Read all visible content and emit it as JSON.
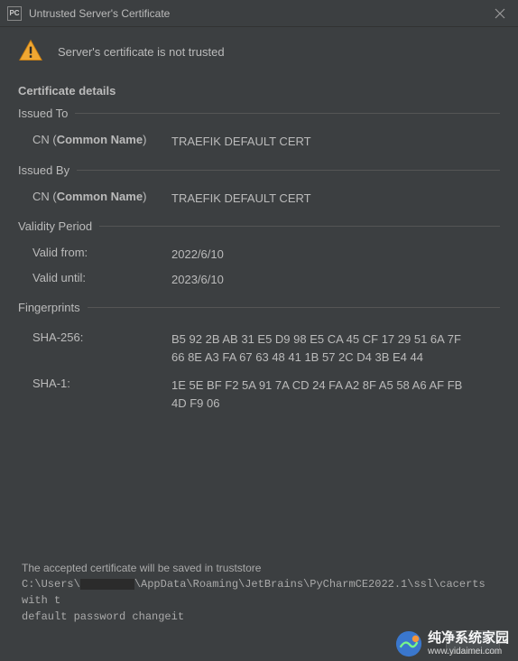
{
  "titlebar": {
    "title": "Untrusted Server's Certificate"
  },
  "header": {
    "message": "Server's certificate is not trusted"
  },
  "details": {
    "title": "Certificate details",
    "issued_to": {
      "label": "Issued To",
      "cn_prefix": "CN (",
      "cn_bold": "Common Name",
      "cn_suffix": ")",
      "value": "TRAEFIK DEFAULT CERT"
    },
    "issued_by": {
      "label": "Issued By",
      "cn_prefix": "CN (",
      "cn_bold": "Common Name",
      "cn_suffix": ")",
      "value": "TRAEFIK DEFAULT CERT"
    },
    "validity": {
      "label": "Validity Period",
      "from_label": "Valid from:",
      "from_value": "2022/6/10",
      "until_label": "Valid until:",
      "until_value": "2023/6/10"
    },
    "fingerprints": {
      "label": "Fingerprints",
      "sha256_label": "SHA-256:",
      "sha256_value": "B5 92 2B AB 31 E5 D9 98 E5 CA 45 CF 17 29 51 6A 7F 66 8E A3 FA 67 63 48 41 1B 57 2C D4 3B E4 44",
      "sha1_label": "SHA-1:",
      "sha1_value": "1E 5E BF F2 5A 91 7A CD 24 FA A2 8F A5 58 A6 AF FB 4D F9 06"
    }
  },
  "footer": {
    "note_line1": "The accepted certificate will be saved in truststore",
    "path_prefix": "C:\\Users\\",
    "path_suffix": "\\AppData\\Roaming\\JetBrains\\PyCharmCE2022.1\\ssl\\cacerts with t",
    "note_line3": "default password changeit"
  },
  "watermark": {
    "cn": "纯净系统家园",
    "url": "www.yidaimei.com"
  }
}
